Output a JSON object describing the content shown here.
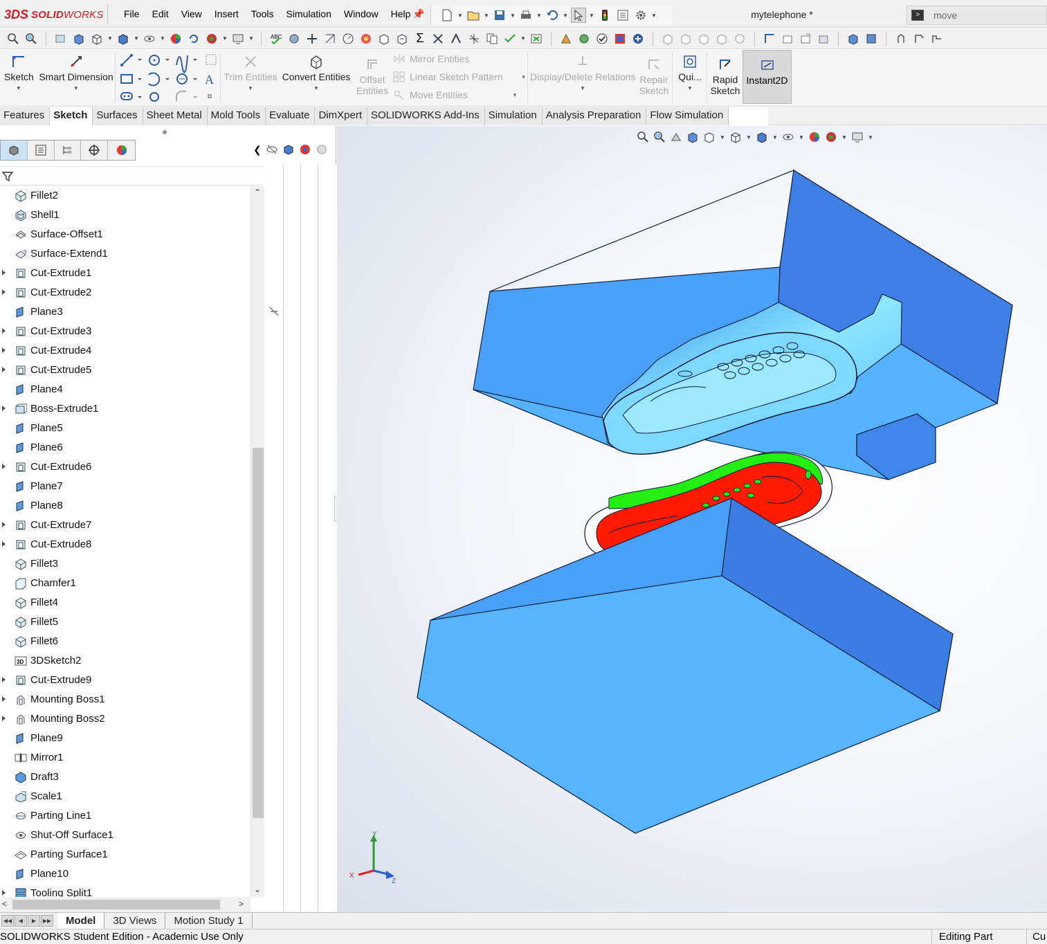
{
  "app": {
    "brand_ds": "3DS",
    "brand_name_bold": "SOLID",
    "brand_name": "WORKS",
    "document_title": "mytelephone *",
    "search_placeholder": "move"
  },
  "menu": [
    "File",
    "Edit",
    "View",
    "Insert",
    "Tools",
    "Simulation",
    "Window",
    "Help"
  ],
  "command_manager": {
    "sketch": "Sketch",
    "smart_dimension": "Smart Dimension",
    "trim_entities": "Trim Entities",
    "convert_entities": "Convert Entities",
    "offset_entities_1": "Offset",
    "offset_entities_2": "Entities",
    "mirror_entities": "Mirror Entities",
    "linear_sketch_pattern": "Linear Sketch Pattern",
    "move_entities": "Move Entities",
    "display_delete_relations": "Display/Delete Relations",
    "repair_sketch_1": "Repair",
    "repair_sketch_2": "Sketch",
    "quick_snaps": "Qui...",
    "rapid_sketch_1": "Rapid",
    "rapid_sketch_2": "Sketch",
    "instant2d": "Instant2D"
  },
  "tabs": [
    {
      "label": "Features",
      "active": false
    },
    {
      "label": "Sketch",
      "active": true
    },
    {
      "label": "Surfaces",
      "active": false
    },
    {
      "label": "Sheet Metal",
      "active": false
    },
    {
      "label": "Mold Tools",
      "active": false
    },
    {
      "label": "Evaluate",
      "active": false
    },
    {
      "label": "DimXpert",
      "active": false
    },
    {
      "label": "SOLIDWORKS Add-Ins",
      "active": false
    },
    {
      "label": "Simulation",
      "active": false
    },
    {
      "label": "Analysis Preparation",
      "active": false
    },
    {
      "label": "Flow Simulation",
      "active": false
    }
  ],
  "feature_tree": [
    {
      "label": "Fillet2",
      "icon": "fillet-icon",
      "expandable": false
    },
    {
      "label": "Shell1",
      "icon": "shell-icon",
      "expandable": false
    },
    {
      "label": "Surface-Offset1",
      "icon": "surface-offset-icon",
      "expandable": false
    },
    {
      "label": "Surface-Extend1",
      "icon": "surface-extend-icon",
      "expandable": false
    },
    {
      "label": "Cut-Extrude1",
      "icon": "cut-extrude-icon",
      "expandable": true
    },
    {
      "label": "Cut-Extrude2",
      "icon": "cut-extrude-icon",
      "expandable": true
    },
    {
      "label": "Plane3",
      "icon": "plane-icon",
      "expandable": false
    },
    {
      "label": "Cut-Extrude3",
      "icon": "cut-extrude-icon",
      "expandable": true
    },
    {
      "label": "Cut-Extrude4",
      "icon": "cut-extrude-icon",
      "expandable": true
    },
    {
      "label": "Cut-Extrude5",
      "icon": "cut-extrude-icon",
      "expandable": true
    },
    {
      "label": "Plane4",
      "icon": "plane-icon",
      "expandable": false
    },
    {
      "label": "Boss-Extrude1",
      "icon": "boss-extrude-icon",
      "expandable": true
    },
    {
      "label": "Plane5",
      "icon": "plane-icon",
      "expandable": false
    },
    {
      "label": "Plane6",
      "icon": "plane-icon",
      "expandable": false
    },
    {
      "label": "Cut-Extrude6",
      "icon": "cut-extrude-icon",
      "expandable": true
    },
    {
      "label": "Plane7",
      "icon": "plane-icon",
      "expandable": false
    },
    {
      "label": "Plane8",
      "icon": "plane-icon",
      "expandable": false
    },
    {
      "label": "Cut-Extrude7",
      "icon": "cut-extrude-icon",
      "expandable": true
    },
    {
      "label": "Cut-Extrude8",
      "icon": "cut-extrude-icon",
      "expandable": true
    },
    {
      "label": "Fillet3",
      "icon": "fillet-icon",
      "expandable": false
    },
    {
      "label": "Chamfer1",
      "icon": "chamfer-icon",
      "expandable": false
    },
    {
      "label": "Fillet4",
      "icon": "fillet-icon",
      "expandable": false
    },
    {
      "label": "Fillet5",
      "icon": "fillet-icon",
      "expandable": false
    },
    {
      "label": "Fillet6",
      "icon": "fillet-icon",
      "expandable": false
    },
    {
      "label": "3DSketch2",
      "icon": "3d-sketch-icon",
      "expandable": false
    },
    {
      "label": "Cut-Extrude9",
      "icon": "cut-extrude-icon",
      "expandable": true
    },
    {
      "label": "Mounting Boss1",
      "icon": "mounting-boss-icon",
      "expandable": true
    },
    {
      "label": "Mounting Boss2",
      "icon": "mounting-boss-icon",
      "expandable": true
    },
    {
      "label": "Plane9",
      "icon": "plane-icon",
      "expandable": false
    },
    {
      "label": "Mirror1",
      "icon": "mirror-icon",
      "expandable": false
    },
    {
      "label": "Draft3",
      "icon": "draft-icon",
      "expandable": false
    },
    {
      "label": "Scale1",
      "icon": "scale-icon",
      "expandable": false
    },
    {
      "label": "Parting Line1",
      "icon": "parting-line-icon",
      "expandable": false
    },
    {
      "label": "Shut-Off Surface1",
      "icon": "shut-off-surface-icon",
      "expandable": false
    },
    {
      "label": "Parting Surface1",
      "icon": "parting-surface-icon",
      "expandable": false
    },
    {
      "label": "Plane10",
      "icon": "plane-icon",
      "expandable": false
    },
    {
      "label": "Tooling Split1",
      "icon": "tooling-split-icon",
      "expandable": true
    }
  ],
  "bottom_tabs": [
    {
      "label": "Model",
      "active": true
    },
    {
      "label": "3D Views",
      "active": false
    },
    {
      "label": "Motion Study 1",
      "active": false
    }
  ],
  "status": {
    "left": "SOLIDWORKS Student Edition - Academic Use Only",
    "mode": "Editing Part",
    "unit": "Cu"
  },
  "triad": {
    "x": "X",
    "y": "Y",
    "z": "Z"
  },
  "colors": {
    "mold_blue": "#4e9df5",
    "mold_blue_dark": "#3b7fe0",
    "mold_cavity": "#8ee6ff",
    "core_red": "#ff1a00",
    "core_green": "#22ee11",
    "brand_red": "#d22027"
  }
}
